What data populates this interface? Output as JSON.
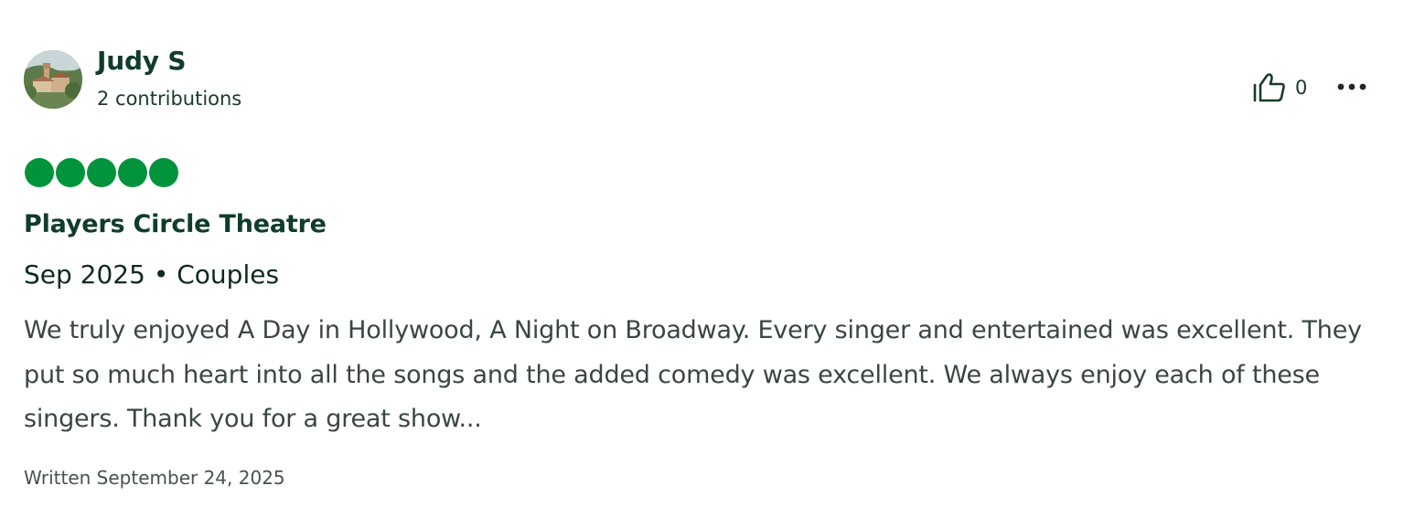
{
  "review": {
    "author": {
      "name": "Judy S",
      "contributions": "2 contributions",
      "avatar_icon": "user-avatar-photo"
    },
    "helpful": {
      "icon": "thumbs-up-icon",
      "count": "0"
    },
    "more_icon": "more-options-icon",
    "rating": {
      "value": 5,
      "max": 5,
      "color": "#00933b"
    },
    "title": "Players Circle Theatre",
    "visit_info": "Sep 2025 • Couples",
    "body": "We truly enjoyed A Day in Hollywood, A Night on Broadway. Every singer and entertained was excellent. They put so much heart into all the songs and the added comedy was excellent. We always enjoy each of these singers. Thank you for a great show...",
    "written": "Written September 24, 2025"
  },
  "colors": {
    "brand_green": "#00933b",
    "heading": "#0f3d2a",
    "body_text": "#3b4640"
  }
}
